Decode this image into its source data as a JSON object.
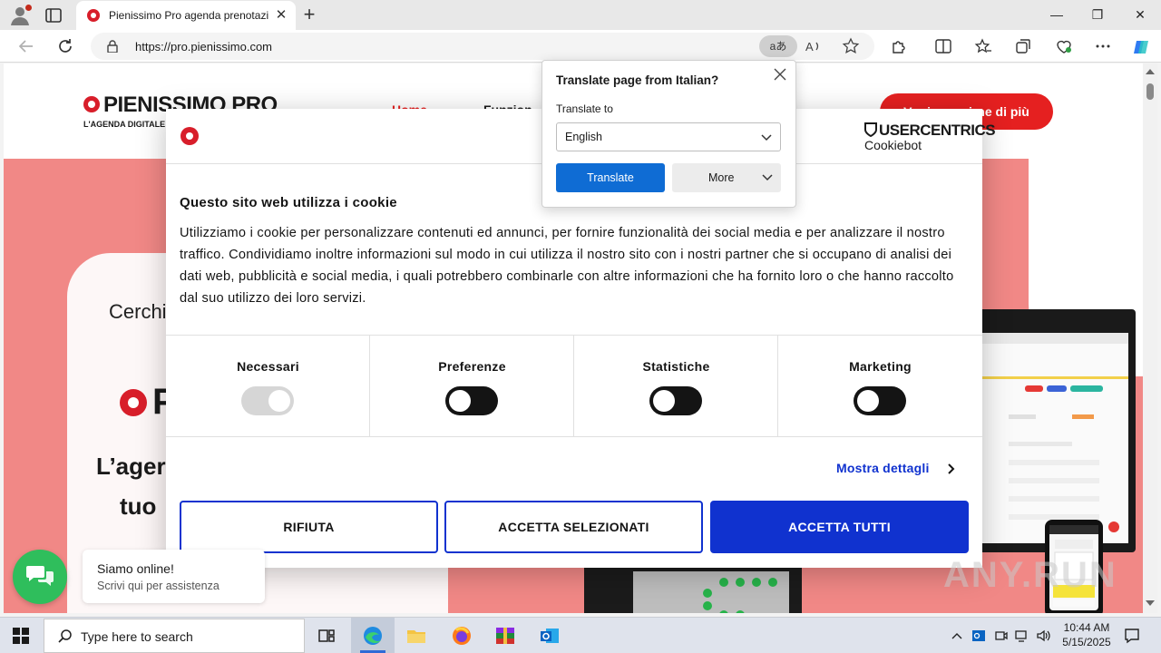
{
  "browser": {
    "tab_title": "Pienissimo Pro agenda prenotazi",
    "url": "https://pro.pienissimo.com",
    "translate_chip": "aあ",
    "icons": [
      "profile-icon",
      "tabs-icon",
      "back-icon",
      "refresh-icon",
      "lock-icon",
      "read-aloud-icon",
      "favorite-icon",
      "extensions-icon",
      "split-screen-icon",
      "favorites-icon",
      "collections-icon",
      "browser-essentials-icon",
      "more-icon",
      "copilot-icon"
    ]
  },
  "site": {
    "logo_name": "PIENISSIMO PRO",
    "logo_tagline": "L'AGENDA DIGITALE",
    "nav": [
      "Home",
      "Funzion"
    ],
    "cta": "Vuoi scoprirne di più",
    "hero_partial": "Cerchi",
    "hero_logo_letter": "P",
    "hero_line1": "L’ager",
    "hero_line2": "tuo"
  },
  "translate": {
    "title": "Translate page from Italian?",
    "sub": "Translate to",
    "language": "English",
    "translate_btn": "Translate",
    "more_btn": "More"
  },
  "cookie": {
    "brand_uc": "USERCENTRICS",
    "brand_cb": "Cookiebot",
    "heading": "Questo sito web utilizza i cookie",
    "body": "Utilizziamo i cookie per personalizzare contenuti ed annunci, per fornire funzionalità dei social media e per analizzare il nostro traffico. Condividiamo inoltre informazioni sul modo in cui utilizza il nostro sito con i nostri partner che si occupano di analisi dei dati web, pubblicità e social media, i quali potrebbero combinarle con altre informazioni che ha fornito loro o che hanno raccolto dal suo utilizzo dei loro servizi.",
    "categories": [
      {
        "label": "Necessari",
        "on": true,
        "disabled": true
      },
      {
        "label": "Preferenze",
        "on": false,
        "disabled": false
      },
      {
        "label": "Statistiche",
        "on": false,
        "disabled": false
      },
      {
        "label": "Marketing",
        "on": false,
        "disabled": false
      }
    ],
    "details_link": "Mostra dettagli",
    "btn_reject": "RIFIUTA",
    "btn_selected": "ACCETTA SELEZIONATI",
    "btn_all": "ACCETTA TUTTI",
    "accent": "#1032cf"
  },
  "chat": {
    "line1": "Siamo online!",
    "line2": "Scrivi qui per assistenza"
  },
  "watermark": "ANY.RUN",
  "taskbar": {
    "search_placeholder": "Type here to search",
    "time": "10:44 AM",
    "date": "5/15/2025"
  }
}
